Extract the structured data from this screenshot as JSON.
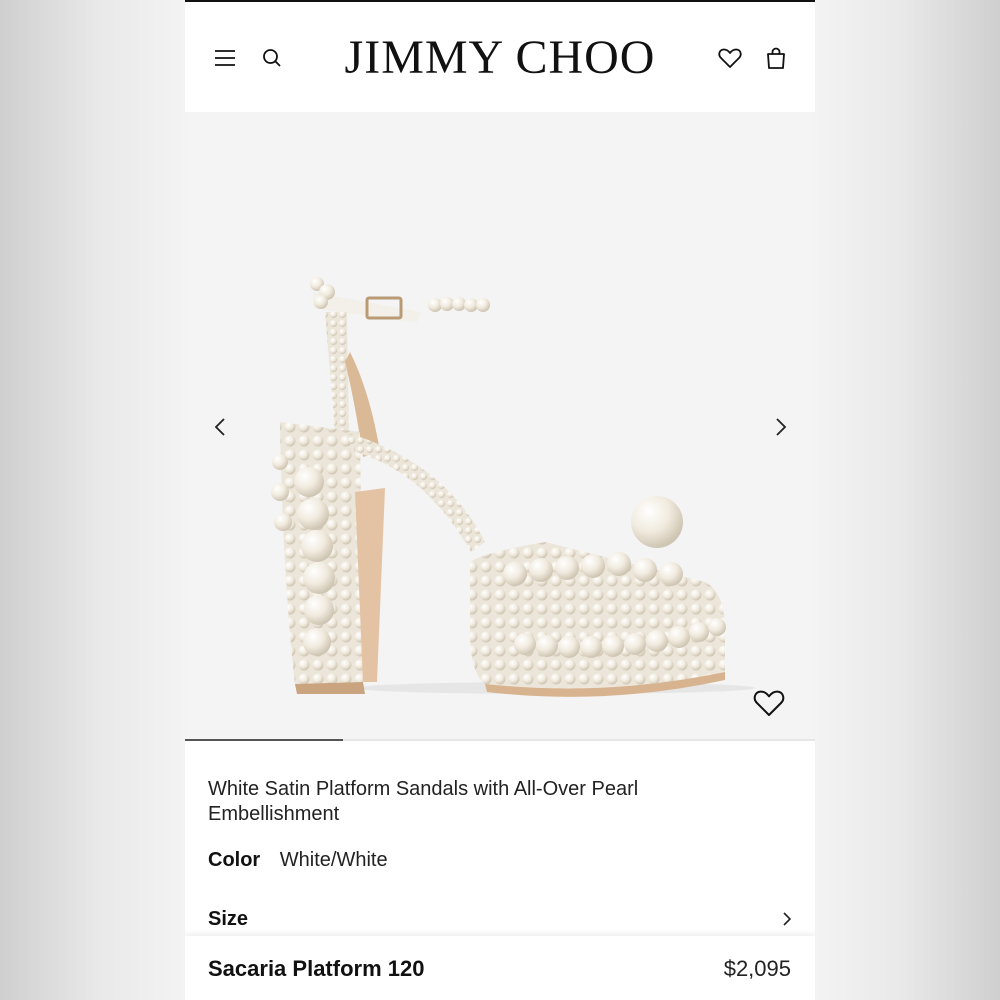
{
  "header": {
    "logo": "JIMMY CHOO",
    "icons": [
      "menu-icon",
      "search-icon",
      "heart-icon",
      "bag-icon"
    ]
  },
  "gallery": {
    "image_alt": "White satin platform sandal covered in pearls",
    "prev_icon": "chevron-left-icon",
    "next_icon": "chevron-right-icon",
    "wishlist_icon": "heart-icon",
    "progress_fraction": 0.25
  },
  "product": {
    "title": "White Satin Platform Sandals with All-Over Pearl Embellishment",
    "color_label": "Color",
    "color_value": "White/White",
    "size_label": "Size",
    "name": "Sacaria Platform 120",
    "price": "$2,095"
  },
  "colors": {
    "text": "#111111",
    "gallery_bg": "#f4f4f4",
    "pearl": "#f3ede2",
    "heel_sole": "#e8c9ae"
  }
}
